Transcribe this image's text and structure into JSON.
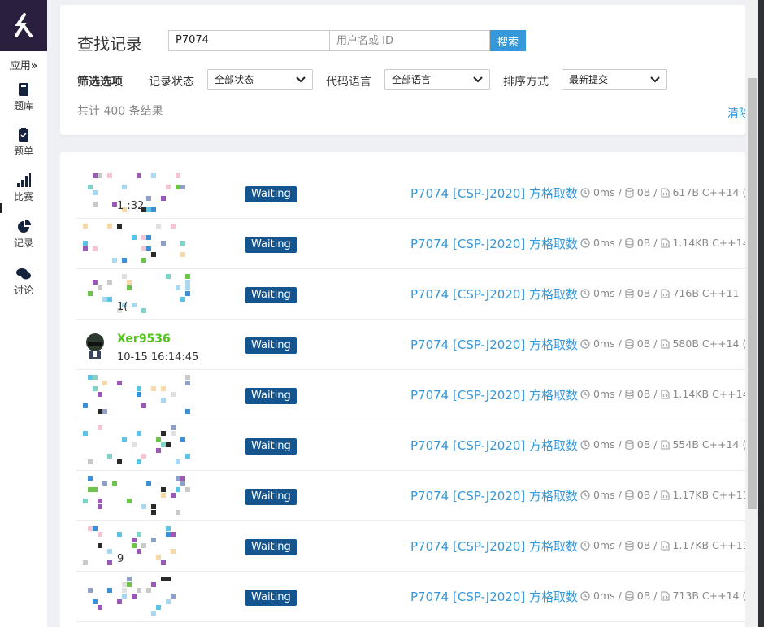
{
  "sidebar": {
    "apps_label": "应用",
    "apps_chevron": "»",
    "items": [
      {
        "label": "题库",
        "icon": "book-icon"
      },
      {
        "label": "题单",
        "icon": "clipboard-icon"
      },
      {
        "label": "比赛",
        "icon": "bar-chart-icon"
      },
      {
        "label": "记录",
        "icon": "pie-chart-icon"
      },
      {
        "label": "讨论",
        "icon": "comments-icon"
      }
    ]
  },
  "filter": {
    "title": "查找记录",
    "problem_input_value": "P7074",
    "user_input_placeholder": "用户名或 ID",
    "search_button": "搜索",
    "filter_label": "筛选选项",
    "status_label": "记录状态",
    "status_value": "全部状态",
    "language_label": "代码语言",
    "language_value": "全部语言",
    "sort_label": "排序方式",
    "sort_value": "最新提交",
    "result_count": "共计 400 条结果",
    "clear_link": "清除"
  },
  "records": [
    {
      "user": "",
      "time": "1 :32",
      "status": "Waiting",
      "problem": "P7074 [CSP-J2020] 方格取数",
      "time_used": "0ms",
      "memory": "0B",
      "code_size": "617B",
      "language": "C++14 ("
    },
    {
      "user": "",
      "time": "",
      "status": "Waiting",
      "problem": "P7074 [CSP-J2020] 方格取数",
      "time_used": "0ms",
      "memory": "0B",
      "code_size": "1.14KB",
      "language": "C++14"
    },
    {
      "user": "",
      "time": "1(",
      "status": "Waiting",
      "problem": "P7074 [CSP-J2020] 方格取数",
      "time_used": "0ms",
      "memory": "0B",
      "code_size": "716B",
      "language": "C++11"
    },
    {
      "user": "Xer9536",
      "time": "10-15 16:14:45",
      "status": "Waiting",
      "problem": "P7074 [CSP-J2020] 方格取数",
      "time_used": "0ms",
      "memory": "0B",
      "code_size": "580B",
      "language": "C++14 ("
    },
    {
      "user": "",
      "time": "",
      "status": "Waiting",
      "problem": "P7074 [CSP-J2020] 方格取数",
      "time_used": "0ms",
      "memory": "0B",
      "code_size": "1.14KB",
      "language": "C++14"
    },
    {
      "user": "",
      "time": "",
      "status": "Waiting",
      "problem": "P7074 [CSP-J2020] 方格取数",
      "time_used": "0ms",
      "memory": "0B",
      "code_size": "554B",
      "language": "C++14 ("
    },
    {
      "user": "",
      "time": "",
      "status": "Waiting",
      "problem": "P7074 [CSP-J2020] 方格取数",
      "time_used": "0ms",
      "memory": "0B",
      "code_size": "1.17KB",
      "language": "C++11"
    },
    {
      "user": "",
      "time": "9",
      "status": "Waiting",
      "problem": "P7074 [CSP-J2020] 方格取数",
      "time_used": "0ms",
      "memory": "0B",
      "code_size": "1.17KB",
      "language": "C++11"
    },
    {
      "user": "",
      "time": "",
      "status": "Waiting",
      "problem": "P7074 [CSP-J2020] 方格取数",
      "time_used": "0ms",
      "memory": "0B",
      "code_size": "713B",
      "language": "C++14 ("
    }
  ],
  "colors": {
    "accent": "#3498db",
    "status_waiting": "#14558f",
    "username_green": "#52c41a",
    "logo_bg": "#2b1f3f"
  }
}
